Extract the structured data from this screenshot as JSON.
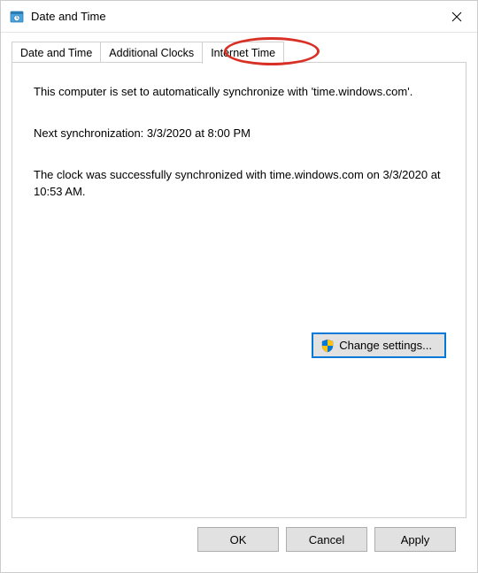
{
  "window": {
    "title": "Date and Time"
  },
  "tabs": {
    "items": [
      {
        "label": "Date and Time"
      },
      {
        "label": "Additional Clocks"
      },
      {
        "label": "Internet Time"
      }
    ],
    "active_index": 2
  },
  "panel": {
    "sync_description": "This computer is set to automatically synchronize with 'time.windows.com'.",
    "next_sync": "Next synchronization: 3/3/2020 at 8:00 PM",
    "last_sync": "The clock was successfully synchronized with time.windows.com on 3/3/2020 at 10:53 AM.",
    "change_settings_label": "Change settings..."
  },
  "footer": {
    "ok": "OK",
    "cancel": "Cancel",
    "apply": "Apply"
  }
}
